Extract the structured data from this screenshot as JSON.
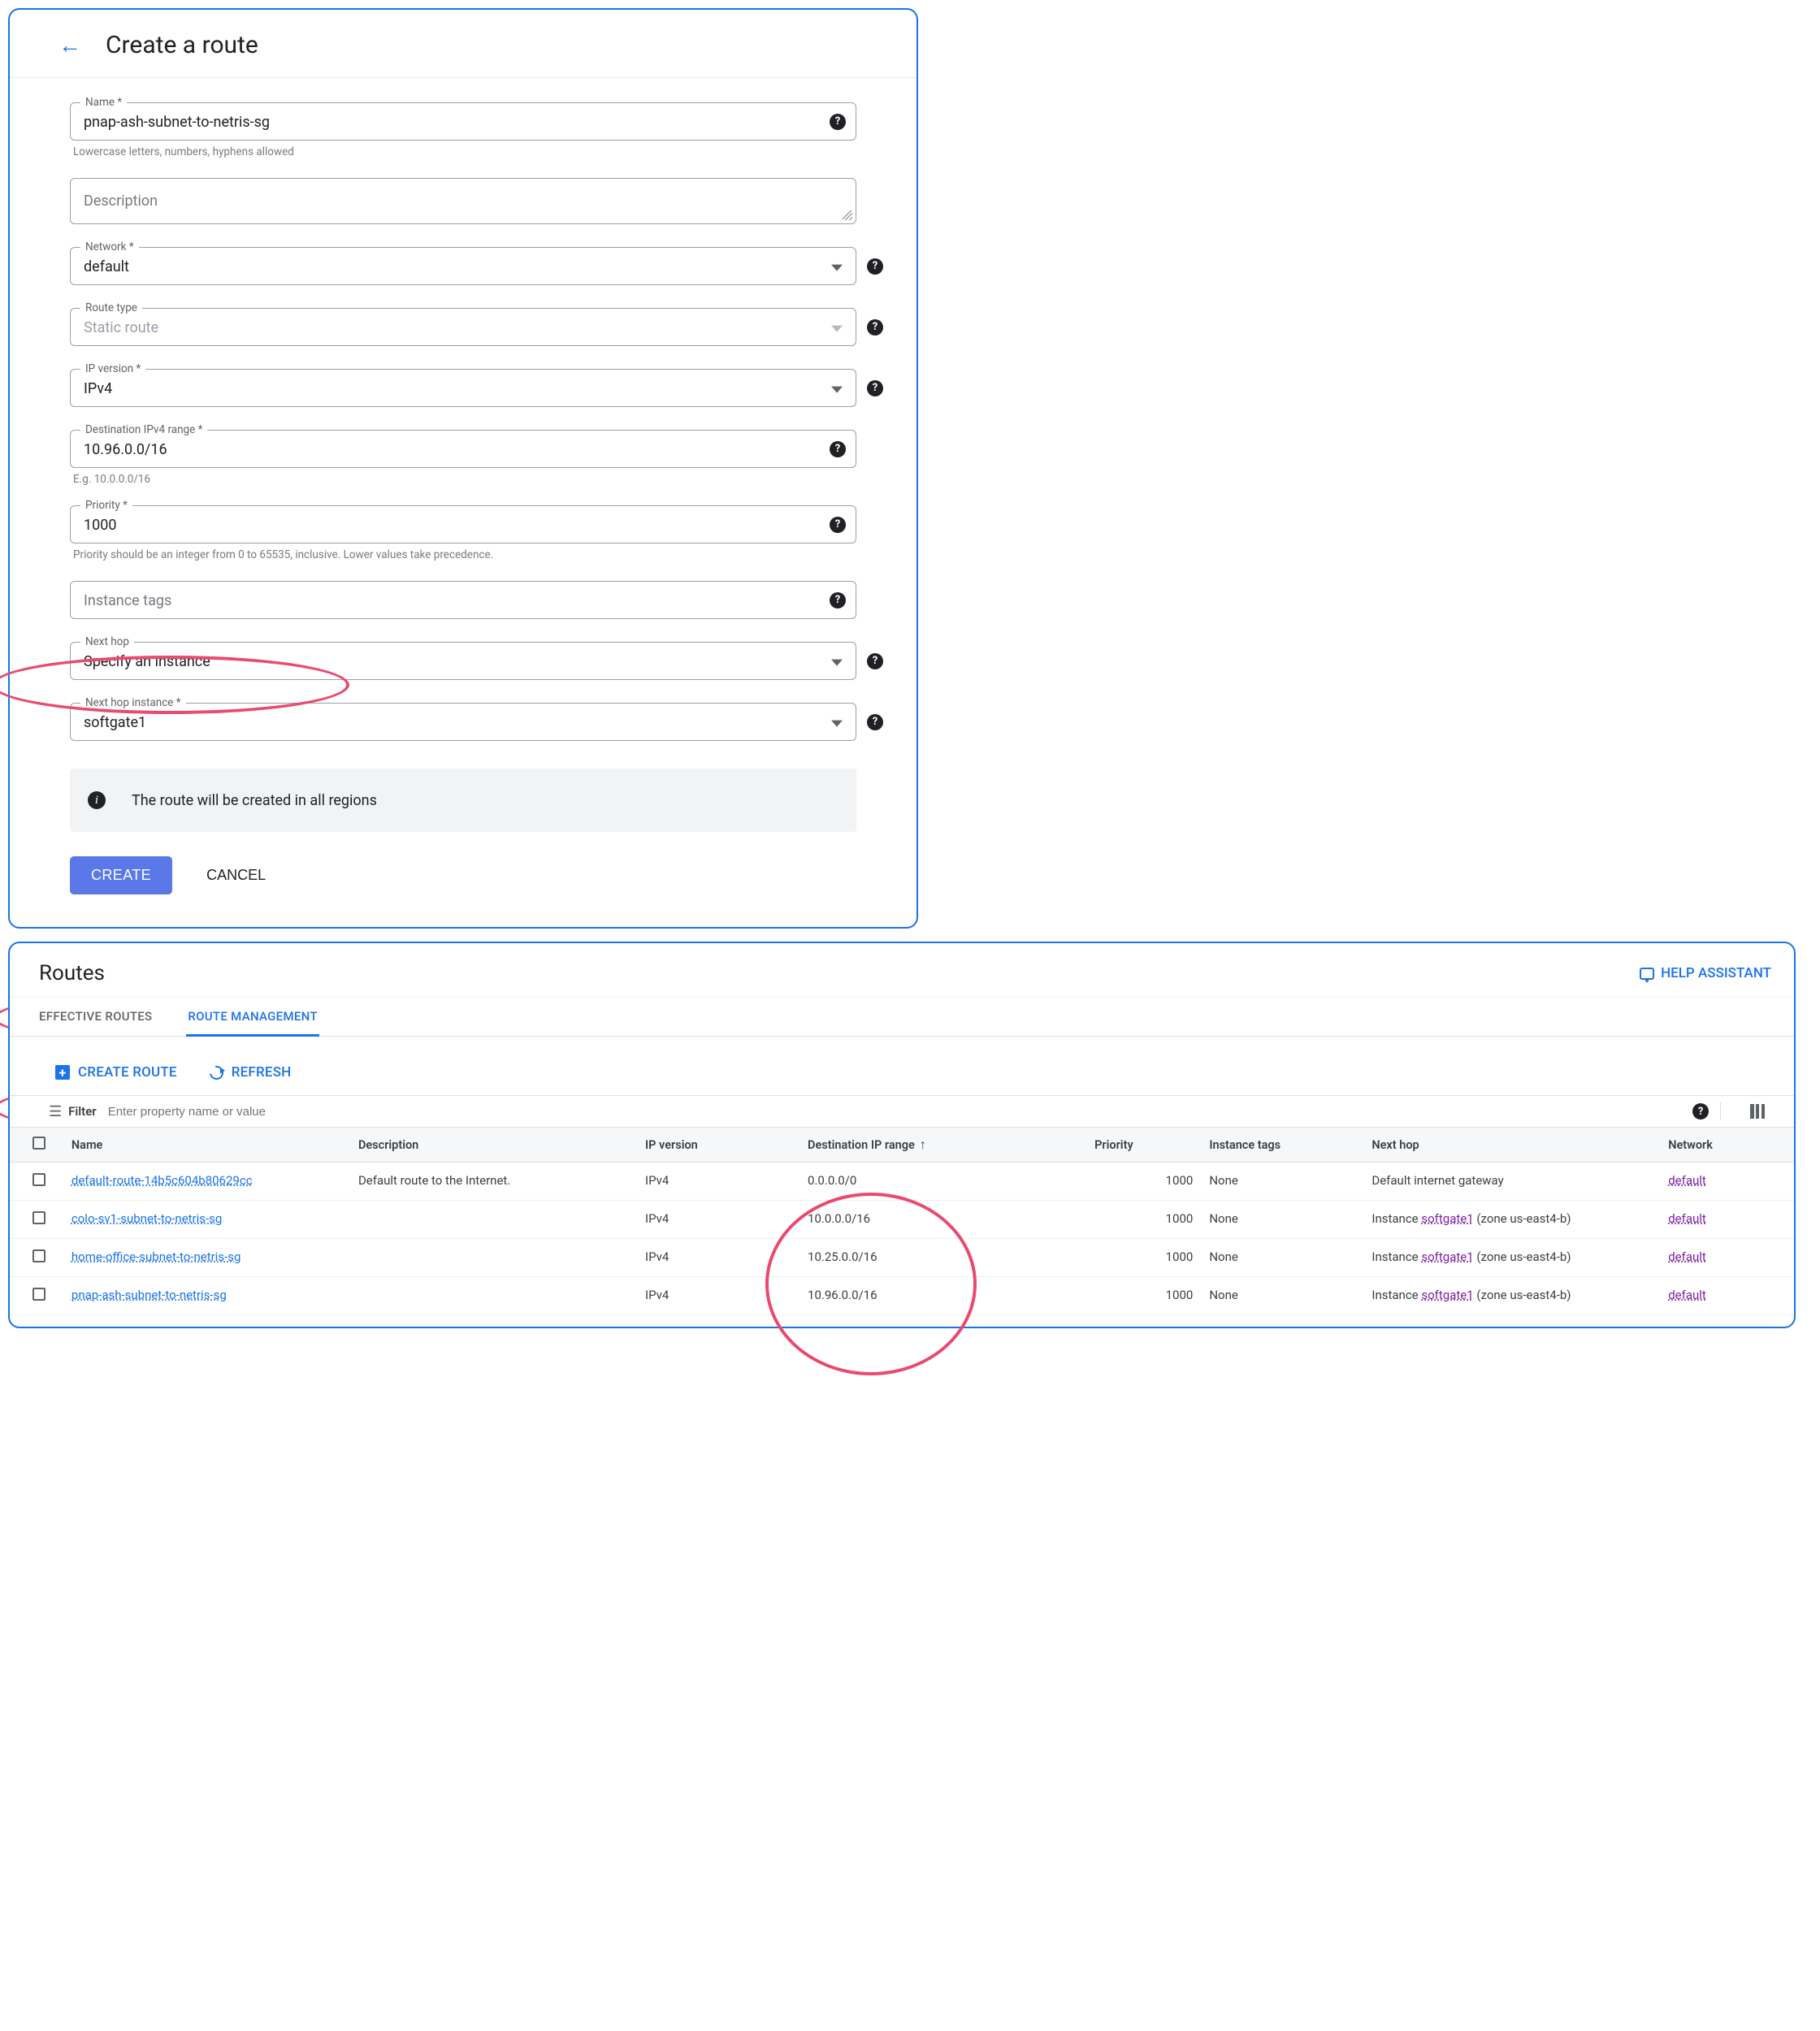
{
  "create": {
    "title": "Create a route",
    "fields": {
      "name": {
        "label": "Name *",
        "value": "pnap-ash-subnet-to-netris-sg",
        "hint": "Lowercase letters, numbers, hyphens allowed"
      },
      "description": {
        "placeholder": "Description"
      },
      "network": {
        "label": "Network *",
        "value": "default"
      },
      "route_type": {
        "label": "Route type",
        "value": "Static route"
      },
      "ip_version": {
        "label": "IP version *",
        "value": "IPv4"
      },
      "dest_range": {
        "label": "Destination IPv4 range *",
        "value": "10.96.0.0/16",
        "hint": "E.g. 10.0.0.0/16"
      },
      "priority": {
        "label": "Priority *",
        "value": "1000",
        "hint": "Priority should be an integer from 0 to 65535, inclusive. Lower values take precedence."
      },
      "instance_tags": {
        "placeholder": "Instance tags"
      },
      "next_hop": {
        "label": "Next hop",
        "value": "Specify an instance"
      },
      "next_hop_instance": {
        "label": "Next hop instance *",
        "value": "softgate1"
      }
    },
    "info": "The route will be created in all regions",
    "buttons": {
      "create": "CREATE",
      "cancel": "CANCEL"
    }
  },
  "routes": {
    "title": "Routes",
    "help_assistant": "HELP ASSISTANT",
    "tabs": {
      "effective": "EFFECTIVE ROUTES",
      "management": "ROUTE MANAGEMENT"
    },
    "actions": {
      "create": "CREATE ROUTE",
      "refresh": "REFRESH"
    },
    "filter": {
      "label": "Filter",
      "placeholder": "Enter property name or value"
    },
    "columns": {
      "name": "Name",
      "description": "Description",
      "ip_version": "IP version",
      "destination": "Destination IP range",
      "priority": "Priority",
      "instance_tags": "Instance tags",
      "next_hop": "Next hop",
      "network": "Network"
    },
    "rows": [
      {
        "name": "default-route-14b5c604b80629cc",
        "description": "Default route to the Internet.",
        "ip_version": "IPv4",
        "destination": "0.0.0.0/0",
        "priority": "1000",
        "instance_tags": "None",
        "next_hop_prefix": "Default internet gateway",
        "next_hop_instance": "",
        "next_hop_suffix": "",
        "network": "default"
      },
      {
        "name": "colo-sv1-subnet-to-netris-sg",
        "description": "",
        "ip_version": "IPv4",
        "destination": "10.0.0.0/16",
        "priority": "1000",
        "instance_tags": "None",
        "next_hop_prefix": "Instance ",
        "next_hop_instance": "softgate1",
        "next_hop_suffix": " (zone us-east4-b)",
        "network": "default"
      },
      {
        "name": "home-office-subnet-to-netris-sg",
        "description": "",
        "ip_version": "IPv4",
        "destination": "10.25.0.0/16",
        "priority": "1000",
        "instance_tags": "None",
        "next_hop_prefix": "Instance ",
        "next_hop_instance": "softgate1",
        "next_hop_suffix": " (zone us-east4-b)",
        "network": "default"
      },
      {
        "name": "pnap-ash-subnet-to-netris-sg",
        "description": "",
        "ip_version": "IPv4",
        "destination": "10.96.0.0/16",
        "priority": "1000",
        "instance_tags": "None",
        "next_hop_prefix": "Instance ",
        "next_hop_instance": "softgate1",
        "next_hop_suffix": " (zone us-east4-b)",
        "network": "default"
      }
    ]
  }
}
